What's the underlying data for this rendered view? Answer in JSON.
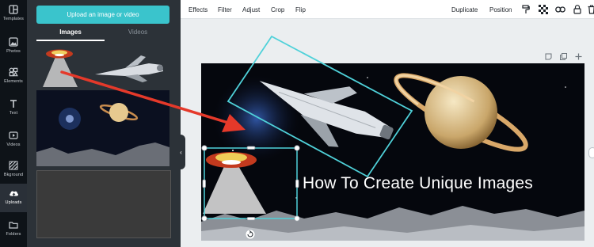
{
  "sidebar": {
    "items": [
      {
        "label": "Templates",
        "icon": "layout-icon"
      },
      {
        "label": "Photos",
        "icon": "image-icon"
      },
      {
        "label": "Elements",
        "icon": "shapes-icon"
      },
      {
        "label": "Text",
        "icon": "text-icon"
      },
      {
        "label": "Videos",
        "icon": "video-icon"
      },
      {
        "label": "Bkground",
        "icon": "hatch-icon"
      },
      {
        "label": "Uploads",
        "icon": "cloud-upload-icon"
      },
      {
        "label": "Folders",
        "icon": "folder-icon"
      }
    ],
    "active": "Uploads"
  },
  "panel": {
    "upload_button": "Upload an image or video",
    "tabs": [
      {
        "label": "Images",
        "active": true
      },
      {
        "label": "Videos",
        "active": false
      }
    ]
  },
  "toolbar": {
    "left": [
      "Effects",
      "Filter",
      "Adjust",
      "Crop",
      "Flip"
    ],
    "right": [
      "Duplicate",
      "Position"
    ],
    "icons": [
      "paint-roller-icon",
      "transparency-icon",
      "link-icon",
      "lock-icon",
      "trash-icon"
    ]
  },
  "canvas": {
    "title": "How To Create Unique Images",
    "actions": [
      "note-icon",
      "copy-icon",
      "plus-icon"
    ]
  },
  "colors": {
    "accent": "#3ac4cc",
    "arrow": "#e5392a",
    "rail": "#0e1318",
    "panel": "#2c3238"
  }
}
